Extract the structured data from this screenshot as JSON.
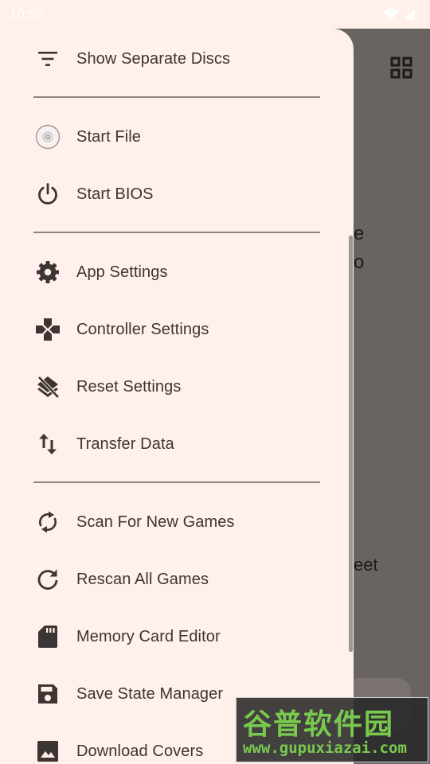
{
  "status_bar": {
    "time": "10:55",
    "icons": [
      "wifi-icon",
      "cell-signal-icon"
    ]
  },
  "background_app": {
    "toolbar_icon": "grid-view-icon",
    "partial_text": [
      "e",
      "o",
      "eet"
    ]
  },
  "drawer": {
    "items": [
      {
        "id": "show-separate-discs",
        "label": "Show Separate Discs",
        "icon": "filter-list-icon"
      },
      {
        "id": "start-file",
        "label": "Start File",
        "icon": "disc-icon"
      },
      {
        "id": "start-bios",
        "label": "Start BIOS",
        "icon": "power-icon"
      },
      {
        "id": "app-settings",
        "label": "App Settings",
        "icon": "gear-icon"
      },
      {
        "id": "controller-settings",
        "label": "Controller Settings",
        "icon": "gamepad-icon"
      },
      {
        "id": "reset-settings",
        "label": "Reset Settings",
        "icon": "layers-clear-icon"
      },
      {
        "id": "transfer-data",
        "label": "Transfer Data",
        "icon": "swap-vertical-icon"
      },
      {
        "id": "scan-for-new-games",
        "label": "Scan For New Games",
        "icon": "sync-icon"
      },
      {
        "id": "rescan-all-games",
        "label": "Rescan All Games",
        "icon": "refresh-icon"
      },
      {
        "id": "memory-card-editor",
        "label": "Memory Card Editor",
        "icon": "sd-card-icon"
      },
      {
        "id": "save-state-manager",
        "label": "Save State Manager",
        "icon": "save-icon"
      },
      {
        "id": "download-covers",
        "label": "Download Covers",
        "icon": "image-icon"
      }
    ]
  },
  "watermark": {
    "brand": "谷普软件园",
    "url": "www.gupuxiazai.com"
  },
  "colors": {
    "drawer_bg": "#fff0ec",
    "scrim": "#696462",
    "text": "#3c3533",
    "icon": "#3c3533",
    "divider": "#8c8583",
    "watermark_green": "#79c94e"
  }
}
